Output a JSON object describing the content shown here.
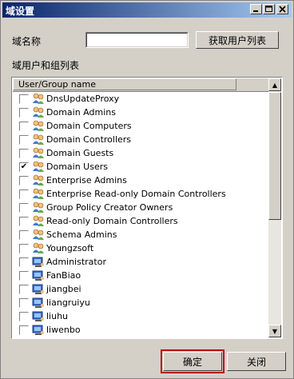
{
  "window": {
    "title": "域设置"
  },
  "form": {
    "domain_label": "域名称",
    "domain_value": "",
    "fetch_button": "获取用户列表",
    "list_label": "域用户和组列表"
  },
  "list": {
    "column_header": "User/Group name",
    "items": [
      {
        "name": "DnsUpdateProxy",
        "checked": false,
        "icon": "group-icon"
      },
      {
        "name": "Domain Admins",
        "checked": false,
        "icon": "group-icon"
      },
      {
        "name": "Domain Computers",
        "checked": false,
        "icon": "group-icon"
      },
      {
        "name": "Domain Controllers",
        "checked": false,
        "icon": "group-icon"
      },
      {
        "name": "Domain Guests",
        "checked": false,
        "icon": "group-icon"
      },
      {
        "name": "Domain Users",
        "checked": true,
        "icon": "group-icon"
      },
      {
        "name": "Enterprise Admins",
        "checked": false,
        "icon": "group-icon"
      },
      {
        "name": "Enterprise Read-only Domain Controllers",
        "checked": false,
        "icon": "group-icon"
      },
      {
        "name": "Group Policy Creator Owners",
        "checked": false,
        "icon": "group-icon"
      },
      {
        "name": "Read-only Domain Controllers",
        "checked": false,
        "icon": "group-icon"
      },
      {
        "name": "Schema Admins",
        "checked": false,
        "icon": "group-icon"
      },
      {
        "name": "Youngzsoft",
        "checked": false,
        "icon": "group-icon"
      },
      {
        "name": "Administrator",
        "checked": false,
        "icon": "user-icon"
      },
      {
        "name": "FanBiao",
        "checked": false,
        "icon": "user-icon"
      },
      {
        "name": "jiangbei",
        "checked": false,
        "icon": "user-icon"
      },
      {
        "name": "liangruiyu",
        "checked": false,
        "icon": "user-icon"
      },
      {
        "name": "liuhu",
        "checked": false,
        "icon": "user-icon"
      },
      {
        "name": "liwenbo",
        "checked": false,
        "icon": "user-icon"
      }
    ]
  },
  "buttons": {
    "ok": "确定",
    "close": "关闭"
  },
  "check_glyph": "✔",
  "colors": {
    "titlebar_start": "#0a246a",
    "titlebar_end": "#a6caf0",
    "focus": "#c00000"
  }
}
